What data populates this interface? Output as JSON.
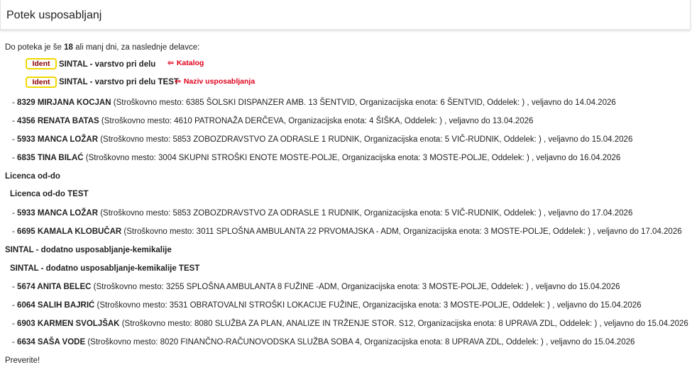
{
  "header": {
    "title": "Potek usposabljanj"
  },
  "intro": {
    "prefix": "Do poteka je še",
    "days": "18",
    "suffix": "ali manj dni, za naslednje delavce:"
  },
  "legend": {
    "badge": "Ident",
    "catalog_name": "SINTAL - varstvo pri delu",
    "training_name": "SINTAL - varstvo pri delu TEST",
    "annotation_catalog": "Katalog",
    "annotation_training": "Naziv usposabljanja",
    "arrow": "⇦"
  },
  "groups": [
    {
      "entries": [
        {
          "dash": "-",
          "name": "8329 MIRJANA KOCJAN",
          "details": "(Stroškovno mesto: 6385 ŠOLSKI DISPANZER AMB. 13 ŠENTVID, Organizacijska enota: 6 ŠENTVID, Oddelek: ) , veljavno do 14.04.2026"
        },
        {
          "dash": "-",
          "name": "4356 RENATA BATAS",
          "details": "(Stroškovno mesto: 4610 PATRONAŽA DERČEVA, Organizacijska enota: 4 ŠIŠKA, Oddelek: ) , veljavno do 13.04.2026"
        },
        {
          "dash": "-",
          "name": "5933 MANCA LOŽAR",
          "details": "(Stroškovno mesto: 5853 ZOBOZDRAVSTVO ZA ODRASLE 1 RUDNIK, Organizacijska enota: 5 VIČ-RUDNIK, Oddelek: ) , veljavno do 15.04.2026"
        },
        {
          "dash": "-",
          "name": "6835 TINA BILAĆ",
          "details": "(Stroškovno mesto: 3004 SKUPNI STROŠKI ENOTE MOSTE-POLJE, Organizacijska enota: 3 MOSTE-POLJE, Oddelek: ) , veljavno do 16.04.2026"
        }
      ]
    },
    {
      "catalog": "Licenca od-do",
      "training": "Licenca od-do TEST",
      "entries": [
        {
          "dash": "-",
          "name": "5933 MANCA LOŽAR",
          "details": "(Stroškovno mesto: 5853 ZOBOZDRAVSTVO ZA ODRASLE 1 RUDNIK, Organizacijska enota: 5 VIČ-RUDNIK, Oddelek: ) , veljavno do 17.04.2026"
        },
        {
          "dash": "-",
          "name": "6695 KAMALA KLOBUČAR",
          "details": "(Stroškovno mesto: 3011 SPLOŠNA AMBULANTA 22 PRVOMAJSKA - ADM, Organizacijska enota: 3 MOSTE-POLJE, Oddelek: ) , veljavno do 17.04.2026"
        }
      ]
    },
    {
      "catalog": "SINTAL - dodatno usposabljanje-kemikalije",
      "training": "SINTAL - dodatno usposabljanje-kemikalije TEST",
      "entries": [
        {
          "dash": "-",
          "name": "5674 ANITA BELEC",
          "details": "(Stroškovno mesto: 3255 SPLOŠNA AMBULANTA 8 FUŽINE -ADM, Organizacijska enota: 3 MOSTE-POLJE, Oddelek: ) , veljavno do 15.04.2026"
        },
        {
          "dash": "-",
          "name": "6064 SALIH BAJRIĆ",
          "details": "(Stroškovno mesto: 3531 OBRATOVALNI STROŠKI LOKACIJE FUŽINE, Organizacijska enota: 3 MOSTE-POLJE, Oddelek: ) , veljavno do 15.04.2026"
        },
        {
          "dash": "-",
          "name": "6903 KARMEN SVOLJŠAK",
          "details": "(Stroškovno mesto: 8080 SLUŽBA ZA PLAN, ANALIZE IN TRŽENJE STOR. S12, Organizacijska enota: 8 UPRAVA ZDL, Oddelek: ) , veljavno do 15.04.2026"
        },
        {
          "dash": "-",
          "name": "6634 SAŠA VODE",
          "details": "(Stroškovno mesto: 8020 FINANČNO-RAČUNOVODSKA SLUŽBA SOBA 4, Organizacijska enota: 8 UPRAVA ZDL, Oddelek: ) , veljavno do 15.04.2026"
        }
      ]
    }
  ],
  "footer": {
    "text": "Preverite!"
  },
  "colors": {
    "badge_border": "#f0d800",
    "badge_text": "#8b0000",
    "annotation": "#e0001b"
  }
}
